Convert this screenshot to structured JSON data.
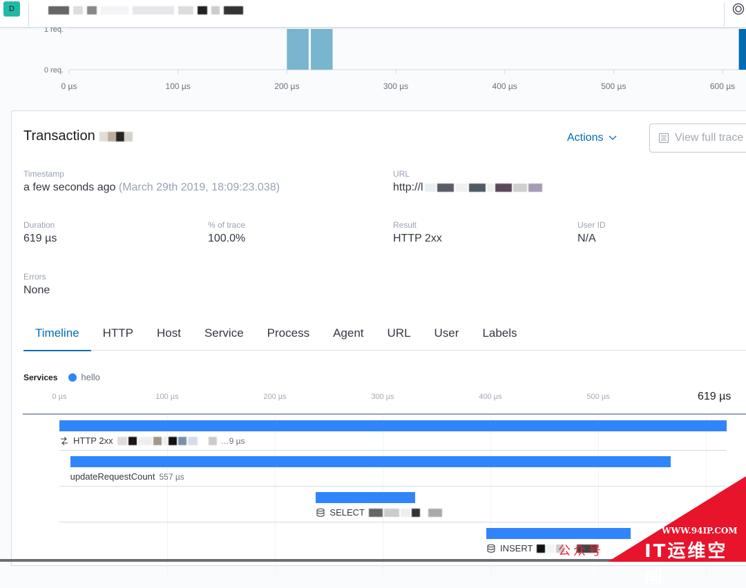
{
  "header": {
    "space_initial": "D",
    "breadcrumb_redacted": true,
    "help_icon": "lifebuoy-icon"
  },
  "histogram": {
    "chart_data": {
      "type": "bar",
      "title": "",
      "xlabel": "",
      "ylabel": "",
      "x_ticks": [
        "0 µs",
        "100 µs",
        "200 µs",
        "300 µs",
        "400 µs",
        "500 µs",
        "600 µs"
      ],
      "y_ticks": [
        "0 req.",
        "1 req."
      ],
      "xlim": [
        0,
        619
      ],
      "ylim": [
        0,
        1
      ],
      "bins": [
        {
          "start": 200,
          "end": 220,
          "value": 1,
          "selected": false
        },
        {
          "start": 222,
          "end": 242,
          "value": 1,
          "selected": false
        },
        {
          "start": 615,
          "end": 635,
          "value": 1,
          "selected": true
        }
      ],
      "colors": {
        "bar": "#7ab5cf",
        "selected": "#006bb4"
      }
    }
  },
  "transaction": {
    "title": "Transaction",
    "actions_label": "Actions",
    "view_trace_label": "View full trace",
    "fields": {
      "timestamp": {
        "label": "Timestamp",
        "value": "a few seconds ago",
        "detail": "(March 29th 2019, 18:09:23.038)"
      },
      "url": {
        "label": "URL",
        "value": "http://l"
      },
      "duration": {
        "label": "Duration",
        "value": "619 µs"
      },
      "percent_trace": {
        "label": "% of trace",
        "value": "100.0%"
      },
      "result": {
        "label": "Result",
        "value": "HTTP 2xx"
      },
      "user_id": {
        "label": "User ID",
        "value": "N/A"
      },
      "errors": {
        "label": "Errors",
        "value": "None"
      }
    },
    "tabs": [
      {
        "label": "Timeline",
        "active": true
      },
      {
        "label": "HTTP",
        "active": false
      },
      {
        "label": "Host",
        "active": false
      },
      {
        "label": "Service",
        "active": false
      },
      {
        "label": "Process",
        "active": false
      },
      {
        "label": "Agent",
        "active": false
      },
      {
        "label": "URL",
        "active": false
      },
      {
        "label": "User",
        "active": false
      },
      {
        "label": "Labels",
        "active": false
      }
    ]
  },
  "timeline": {
    "services_label": "Services",
    "services": [
      {
        "name": "hello",
        "color": "#3185fc"
      }
    ],
    "ticks": [
      "0 µs",
      "100 µs",
      "200 µs",
      "300 µs",
      "400 µs",
      "500 µs"
    ],
    "total_label": "619 µs",
    "total_us": 619,
    "spans": [
      {
        "name": "HTTP 2xx",
        "duration": "…9 µs",
        "start_us": 0,
        "dur_us": 619,
        "icon": "http-arrows-icon"
      },
      {
        "name": "updateRequestCount",
        "duration": "557 µs",
        "start_us": 10,
        "dur_us": 557,
        "icon": null
      },
      {
        "name": "SELECT",
        "duration": "",
        "start_us": 238,
        "dur_us": 92,
        "icon": "database-icon"
      },
      {
        "name": "INSERT",
        "duration": "",
        "start_us": 396,
        "dur_us": 134,
        "icon": "database-icon"
      }
    ]
  },
  "watermark": {
    "url": "WWW.94IP.COM",
    "text": "IT运维空间",
    "red_text": "公众号"
  }
}
